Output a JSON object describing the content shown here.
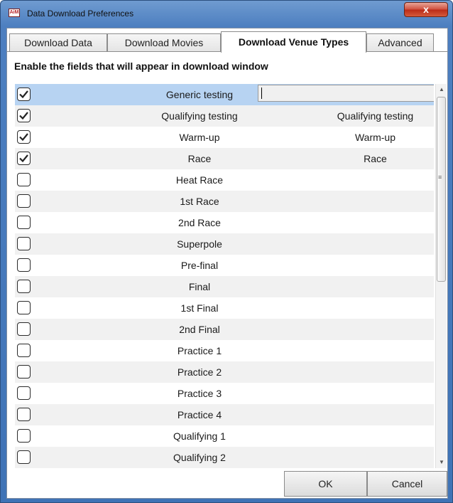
{
  "window": {
    "title": "Data Download Preferences",
    "icon_label": "AiM"
  },
  "tabs": [
    {
      "label": "Download Data",
      "active": false
    },
    {
      "label": "Download Movies",
      "active": false
    },
    {
      "label": "Download Venue Types",
      "active": true
    },
    {
      "label": "Advanced",
      "active": false
    }
  ],
  "heading": "Enable the fields that will appear in download window",
  "rows": [
    {
      "name": "Generic testing",
      "alias": "",
      "checked": true,
      "editing": true
    },
    {
      "name": "Qualifying testing",
      "alias": "Qualifying testing",
      "checked": true
    },
    {
      "name": "Warm-up",
      "alias": "Warm-up",
      "checked": true
    },
    {
      "name": "Race",
      "alias": "Race",
      "checked": true
    },
    {
      "name": "Heat Race",
      "alias": "",
      "checked": false
    },
    {
      "name": "1st Race",
      "alias": "",
      "checked": false
    },
    {
      "name": "2nd Race",
      "alias": "",
      "checked": false
    },
    {
      "name": "Superpole",
      "alias": "",
      "checked": false
    },
    {
      "name": "Pre-final",
      "alias": "",
      "checked": false
    },
    {
      "name": "Final",
      "alias": "",
      "checked": false
    },
    {
      "name": "1st Final",
      "alias": "",
      "checked": false
    },
    {
      "name": "2nd Final",
      "alias": "",
      "checked": false
    },
    {
      "name": "Practice 1",
      "alias": "",
      "checked": false
    },
    {
      "name": "Practice 2",
      "alias": "",
      "checked": false
    },
    {
      "name": "Practice 3",
      "alias": "",
      "checked": false
    },
    {
      "name": "Practice 4",
      "alias": "",
      "checked": false
    },
    {
      "name": "Qualifying 1",
      "alias": "",
      "checked": false
    },
    {
      "name": "Qualifying 2",
      "alias": "",
      "checked": false
    }
  ],
  "buttons": {
    "ok": "OK",
    "cancel": "Cancel",
    "close": "x"
  },
  "icons": {
    "close": "close-icon",
    "check": "check-icon",
    "scroll_up": "scroll-up-icon",
    "scroll_down": "scroll-down-icon"
  }
}
